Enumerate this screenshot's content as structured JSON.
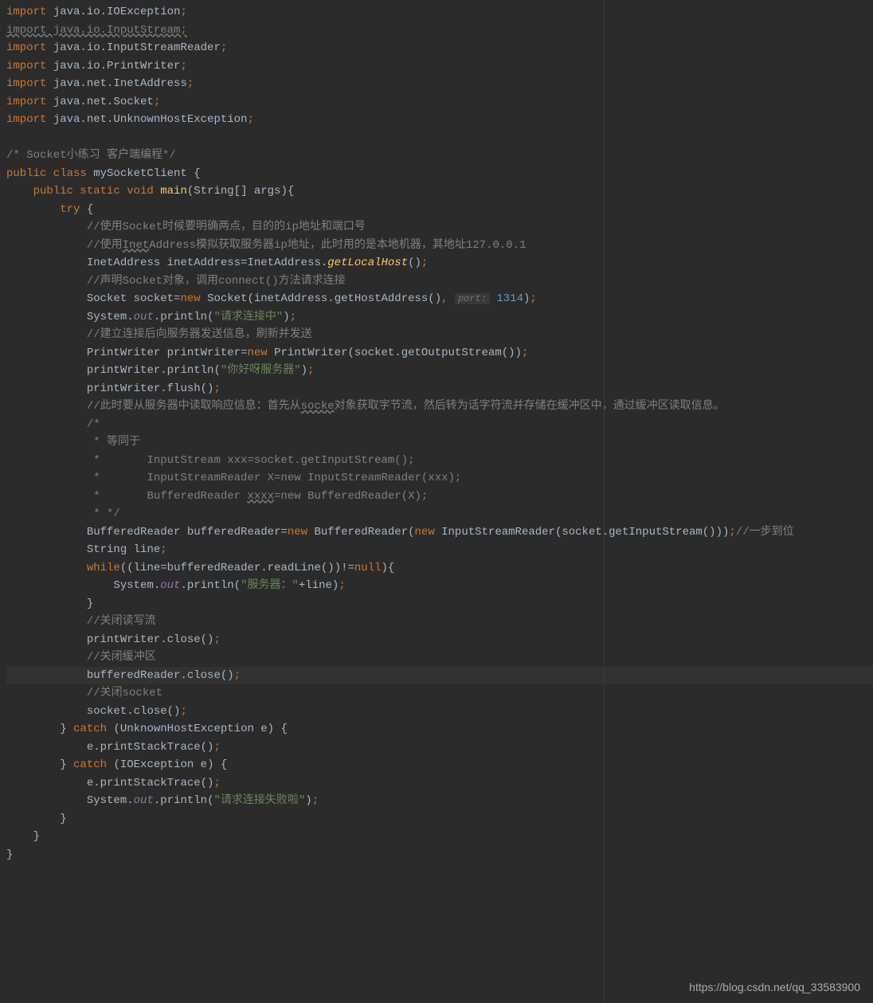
{
  "watermark": "https://blog.csdn.net/qq_33583900",
  "code": {
    "lines": [
      {
        "indent": 0,
        "segments": [
          {
            "t": "import ",
            "c": "keyword"
          },
          {
            "t": "java.io.IOException",
            "c": ""
          },
          {
            "t": ";",
            "c": "keyword"
          }
        ]
      },
      {
        "indent": 0,
        "segments": [
          {
            "t": "import java.io.InputStream;",
            "c": "comment underline-wavy"
          }
        ]
      },
      {
        "indent": 0,
        "segments": [
          {
            "t": "import ",
            "c": "keyword"
          },
          {
            "t": "java.io.InputStreamReader",
            "c": ""
          },
          {
            "t": ";",
            "c": "keyword"
          }
        ]
      },
      {
        "indent": 0,
        "segments": [
          {
            "t": "import ",
            "c": "keyword"
          },
          {
            "t": "java.io.PrintWriter",
            "c": ""
          },
          {
            "t": ";",
            "c": "keyword"
          }
        ]
      },
      {
        "indent": 0,
        "segments": [
          {
            "t": "import ",
            "c": "keyword"
          },
          {
            "t": "java.net.InetAddress",
            "c": ""
          },
          {
            "t": ";",
            "c": "keyword"
          }
        ]
      },
      {
        "indent": 0,
        "segments": [
          {
            "t": "import ",
            "c": "keyword"
          },
          {
            "t": "java.net.Socket",
            "c": ""
          },
          {
            "t": ";",
            "c": "keyword"
          }
        ]
      },
      {
        "indent": 0,
        "segments": [
          {
            "t": "import ",
            "c": "keyword"
          },
          {
            "t": "java.net.UnknownHostException",
            "c": ""
          },
          {
            "t": ";",
            "c": "keyword"
          }
        ]
      },
      {
        "indent": 0,
        "segments": []
      },
      {
        "indent": 0,
        "segments": [
          {
            "t": "/* Socket小练习 客户端编程*/",
            "c": "comment"
          }
        ]
      },
      {
        "indent": 0,
        "segments": [
          {
            "t": "public class ",
            "c": "keyword"
          },
          {
            "t": "mySocketClient {",
            "c": ""
          }
        ]
      },
      {
        "indent": 1,
        "segments": [
          {
            "t": "public static void ",
            "c": "keyword"
          },
          {
            "t": "main",
            "c": "method"
          },
          {
            "t": "(String[] args){",
            "c": ""
          }
        ]
      },
      {
        "indent": 2,
        "segments": [
          {
            "t": "try ",
            "c": "keyword"
          },
          {
            "t": "{",
            "c": ""
          }
        ]
      },
      {
        "indent": 3,
        "segments": [
          {
            "t": "//使用Socket时候要明确两点，目的的ip地址和端口号",
            "c": "comment"
          }
        ]
      },
      {
        "indent": 3,
        "segments": [
          {
            "t": "//使用",
            "c": "comment"
          },
          {
            "t": "Inet",
            "c": "comment underline-wavy"
          },
          {
            "t": "Address模拟获取服务器ip地址，此时用的是本地机器，其地址127.0.0.1",
            "c": "comment"
          }
        ]
      },
      {
        "indent": 3,
        "segments": [
          {
            "t": "InetAddress inetAddress=InetAddress.",
            "c": ""
          },
          {
            "t": "getLocalHost",
            "c": "static-method"
          },
          {
            "t": "()",
            "c": ""
          },
          {
            "t": ";",
            "c": "keyword"
          }
        ]
      },
      {
        "indent": 3,
        "segments": [
          {
            "t": "//声明Socket对象，调用connect()方法请求连接",
            "c": "comment"
          }
        ]
      },
      {
        "indent": 3,
        "segments": [
          {
            "t": "Socket socket=",
            "c": ""
          },
          {
            "t": "new ",
            "c": "keyword"
          },
          {
            "t": "Socket(inetAddress.getHostAddress()",
            "c": ""
          },
          {
            "t": ", ",
            "c": "keyword"
          },
          {
            "t": "port:",
            "c": "param-hint"
          },
          {
            "t": " ",
            "c": ""
          },
          {
            "t": "1314",
            "c": "number"
          },
          {
            "t": ")",
            "c": ""
          },
          {
            "t": ";",
            "c": "keyword"
          }
        ]
      },
      {
        "indent": 3,
        "segments": [
          {
            "t": "System.",
            "c": ""
          },
          {
            "t": "out",
            "c": "static"
          },
          {
            "t": ".println(",
            "c": ""
          },
          {
            "t": "\"请求连接中\"",
            "c": "string"
          },
          {
            "t": ")",
            "c": ""
          },
          {
            "t": ";",
            "c": "keyword"
          }
        ]
      },
      {
        "indent": 3,
        "segments": [
          {
            "t": "//建立连接后向服务器发送信息，刷新并发送",
            "c": "comment"
          }
        ]
      },
      {
        "indent": 3,
        "segments": [
          {
            "t": "PrintWriter printWriter=",
            "c": ""
          },
          {
            "t": "new ",
            "c": "keyword"
          },
          {
            "t": "PrintWriter(socket.getOutputStream())",
            "c": ""
          },
          {
            "t": ";",
            "c": "keyword"
          }
        ]
      },
      {
        "indent": 3,
        "segments": [
          {
            "t": "printWriter.println(",
            "c": ""
          },
          {
            "t": "\"你好呀服务器\"",
            "c": "string"
          },
          {
            "t": ")",
            "c": ""
          },
          {
            "t": ";",
            "c": "keyword"
          }
        ]
      },
      {
        "indent": 3,
        "segments": [
          {
            "t": "printWriter.flush()",
            "c": ""
          },
          {
            "t": ";",
            "c": "keyword"
          }
        ]
      },
      {
        "indent": 3,
        "segments": [
          {
            "t": "//此时要从服务器中读取响应信息：首先从",
            "c": "comment"
          },
          {
            "t": "socke",
            "c": "comment underline-wavy"
          },
          {
            "t": "对象获取字节流，然后转为话字符流并存储在缓冲区中，通过缓冲区读取信息。",
            "c": "comment"
          }
        ]
      },
      {
        "indent": 3,
        "segments": [
          {
            "t": "/*",
            "c": "comment"
          }
        ]
      },
      {
        "indent": 3,
        "segments": [
          {
            "t": " * 等同于",
            "c": "comment"
          }
        ]
      },
      {
        "indent": 3,
        "segments": [
          {
            "t": " *       InputStream xxx=socket.getInputStream();",
            "c": "comment"
          }
        ]
      },
      {
        "indent": 3,
        "segments": [
          {
            "t": " *       InputStreamReader X=new InputStreamReader(xxx);",
            "c": "comment"
          }
        ]
      },
      {
        "indent": 3,
        "segments": [
          {
            "t": " *       BufferedReader ",
            "c": "comment"
          },
          {
            "t": "xxxx",
            "c": "comment underline-wavy"
          },
          {
            "t": "=new BufferedReader(X);",
            "c": "comment"
          }
        ]
      },
      {
        "indent": 3,
        "segments": [
          {
            "t": " * */",
            "c": "comment"
          }
        ]
      },
      {
        "indent": 3,
        "segments": [
          {
            "t": "BufferedReader bufferedReader=",
            "c": ""
          },
          {
            "t": "new ",
            "c": "keyword"
          },
          {
            "t": "BufferedReader(",
            "c": ""
          },
          {
            "t": "new ",
            "c": "keyword"
          },
          {
            "t": "InputStreamReader(socket.getInputStream()))",
            "c": ""
          },
          {
            "t": ";",
            "c": "keyword"
          },
          {
            "t": "//一步到位",
            "c": "comment"
          }
        ]
      },
      {
        "indent": 3,
        "segments": [
          {
            "t": "String line",
            "c": ""
          },
          {
            "t": ";",
            "c": "keyword"
          }
        ]
      },
      {
        "indent": 3,
        "segments": [
          {
            "t": "while",
            "c": "keyword"
          },
          {
            "t": "((line=bufferedReader.readLine())!=",
            "c": ""
          },
          {
            "t": "null",
            "c": "keyword"
          },
          {
            "t": "){",
            "c": ""
          }
        ]
      },
      {
        "indent": 4,
        "segments": [
          {
            "t": "System.",
            "c": ""
          },
          {
            "t": "out",
            "c": "static"
          },
          {
            "t": ".println(",
            "c": ""
          },
          {
            "t": "\"服务器：\"",
            "c": "string"
          },
          {
            "t": "+line)",
            "c": ""
          },
          {
            "t": ";",
            "c": "keyword"
          }
        ]
      },
      {
        "indent": 3,
        "segments": [
          {
            "t": "}",
            "c": ""
          }
        ]
      },
      {
        "indent": 3,
        "segments": [
          {
            "t": "//关闭读写流",
            "c": "comment"
          }
        ]
      },
      {
        "indent": 3,
        "segments": [
          {
            "t": "printWriter.close()",
            "c": ""
          },
          {
            "t": ";",
            "c": "keyword"
          }
        ]
      },
      {
        "indent": 3,
        "segments": [
          {
            "t": "//关闭缓冲区",
            "c": "comment"
          }
        ]
      },
      {
        "indent": 3,
        "active": true,
        "segments": [
          {
            "t": "bufferedReader.close()",
            "c": ""
          },
          {
            "t": ";",
            "c": "keyword"
          }
        ]
      },
      {
        "indent": 3,
        "segments": [
          {
            "t": "//关闭socket",
            "c": "comment"
          }
        ]
      },
      {
        "indent": 3,
        "segments": [
          {
            "t": "socket.close()",
            "c": ""
          },
          {
            "t": ";",
            "c": "keyword"
          }
        ]
      },
      {
        "indent": 2,
        "segments": [
          {
            "t": "} ",
            "c": ""
          },
          {
            "t": "catch ",
            "c": "keyword"
          },
          {
            "t": "(UnknownHostException e) {",
            "c": ""
          }
        ]
      },
      {
        "indent": 3,
        "segments": [
          {
            "t": "e.printStackTrace()",
            "c": ""
          },
          {
            "t": ";",
            "c": "keyword"
          }
        ]
      },
      {
        "indent": 2,
        "segments": [
          {
            "t": "} ",
            "c": ""
          },
          {
            "t": "catch ",
            "c": "keyword"
          },
          {
            "t": "(IOException e) {",
            "c": ""
          }
        ]
      },
      {
        "indent": 3,
        "segments": [
          {
            "t": "e.printStackTrace()",
            "c": ""
          },
          {
            "t": ";",
            "c": "keyword"
          }
        ]
      },
      {
        "indent": 3,
        "segments": [
          {
            "t": "System.",
            "c": ""
          },
          {
            "t": "out",
            "c": "static"
          },
          {
            "t": ".println(",
            "c": ""
          },
          {
            "t": "\"请求连接失败啦\"",
            "c": "string"
          },
          {
            "t": ")",
            "c": ""
          },
          {
            "t": ";",
            "c": "keyword"
          }
        ]
      },
      {
        "indent": 2,
        "segments": [
          {
            "t": "}",
            "c": ""
          }
        ]
      },
      {
        "indent": 1,
        "segments": [
          {
            "t": "}",
            "c": ""
          }
        ]
      },
      {
        "indent": 0,
        "segments": [
          {
            "t": "}",
            "c": ""
          }
        ]
      }
    ]
  }
}
